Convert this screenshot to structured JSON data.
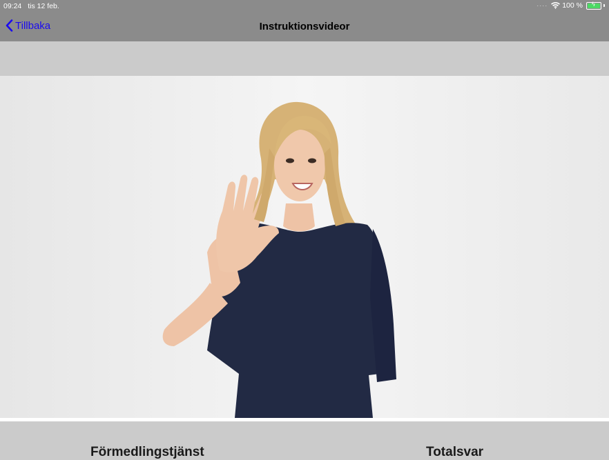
{
  "status_bar": {
    "time": "09:24",
    "date": "tis 12 feb.",
    "battery": "100 %",
    "battery_level": 1.0,
    "icons": [
      "wifi-icon",
      "battery-charging-icon"
    ]
  },
  "nav": {
    "back_label": "Tillbaka",
    "title": "Instruktionsvideor",
    "back_icon": "chevron-left-icon"
  },
  "options": [
    {
      "label": "Förmedlingstjänst"
    },
    {
      "label": "Totalsvar"
    }
  ],
  "colors": {
    "bar_background": "#8b8b8b",
    "page_background": "#cbcbcb",
    "link_blue": "#1a0af0",
    "battery_green": "#4cd964"
  }
}
